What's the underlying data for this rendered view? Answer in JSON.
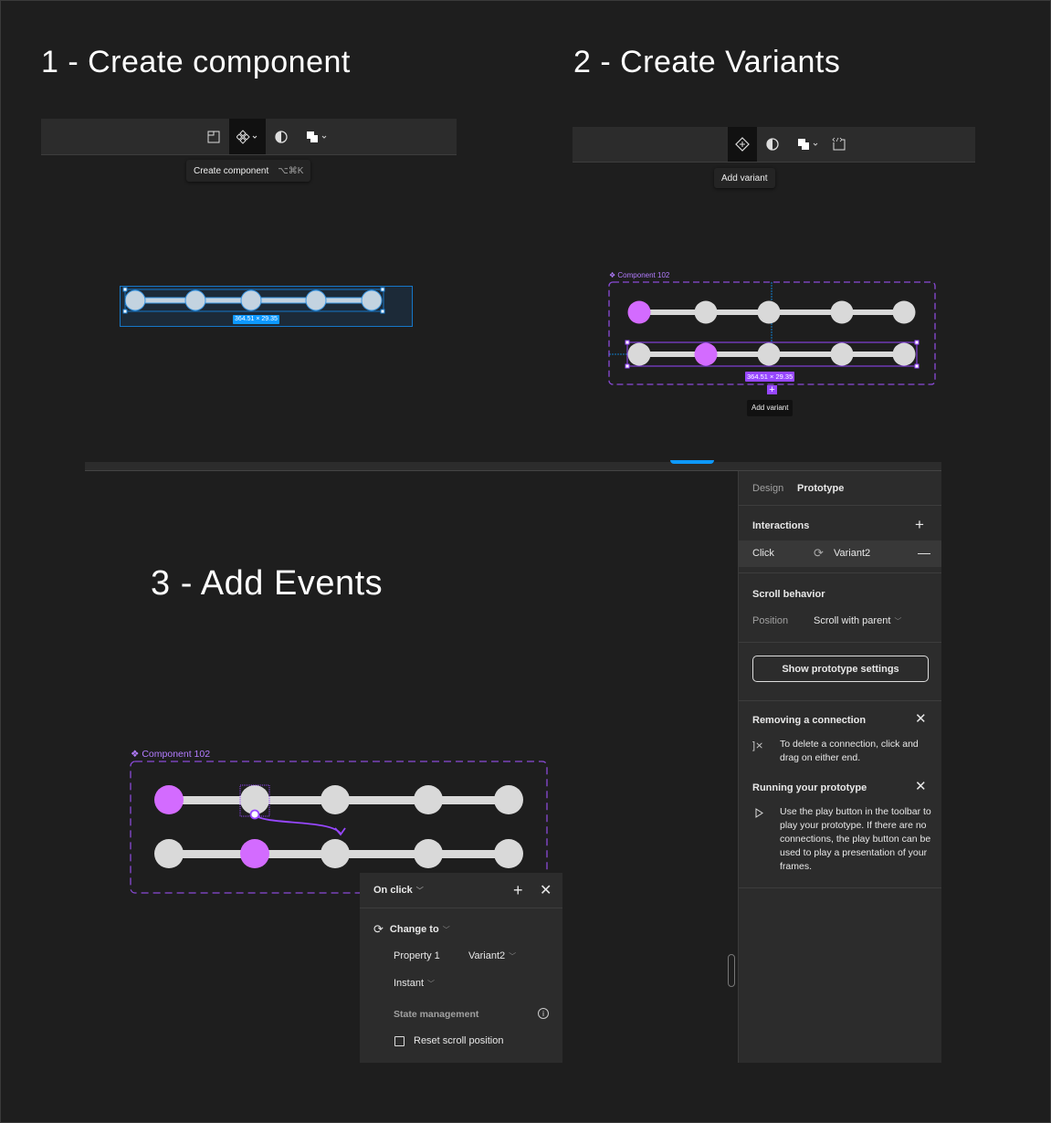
{
  "steps": {
    "step1": "1 - Create component",
    "step2": "2 - Create Variants",
    "step3": "3 - Add Events"
  },
  "toolbar1": {
    "tooltip_label": "Create component",
    "tooltip_shortcut": "⌥⌘K"
  },
  "toolbar2": {
    "tooltip_label": "Add variant"
  },
  "canvas1": {
    "size_label": "364.51 × 29.35"
  },
  "canvas2": {
    "component_name": "Component 102",
    "size_label": "364.51 × 29.35",
    "add_variant_tooltip": "Add variant"
  },
  "canvas3": {
    "component_name": "Component 102"
  },
  "colors": {
    "accent_purple": "#9747ff",
    "active_dot": "#d36bff",
    "dot": "#d9d9d9",
    "selection_blue": "#0d99ff"
  },
  "popup": {
    "trigger": "On click",
    "action": "Change to",
    "property_label": "Property 1",
    "property_value": "Variant2",
    "animation": "Instant",
    "state_management": "State management",
    "reset_scroll": "Reset scroll position",
    "reset_scroll_checked": false
  },
  "right_panel": {
    "tabs": [
      "Design",
      "Prototype"
    ],
    "active_tab": "Prototype",
    "interactions_title": "Interactions",
    "interaction": {
      "trigger": "Click",
      "target": "Variant2"
    },
    "scroll_title": "Scroll behavior",
    "position_label": "Position",
    "position_value": "Scroll with parent",
    "show_settings_button": "Show prototype settings",
    "tip1_title": "Removing a connection",
    "tip1_text": "To delete a connection, click and drag on either end.",
    "tip2_title": "Running your prototype",
    "tip2_text": "Use the play button in the toolbar to play your prototype. If there are no connections, the play button can be used to play a presentation of your frames."
  }
}
